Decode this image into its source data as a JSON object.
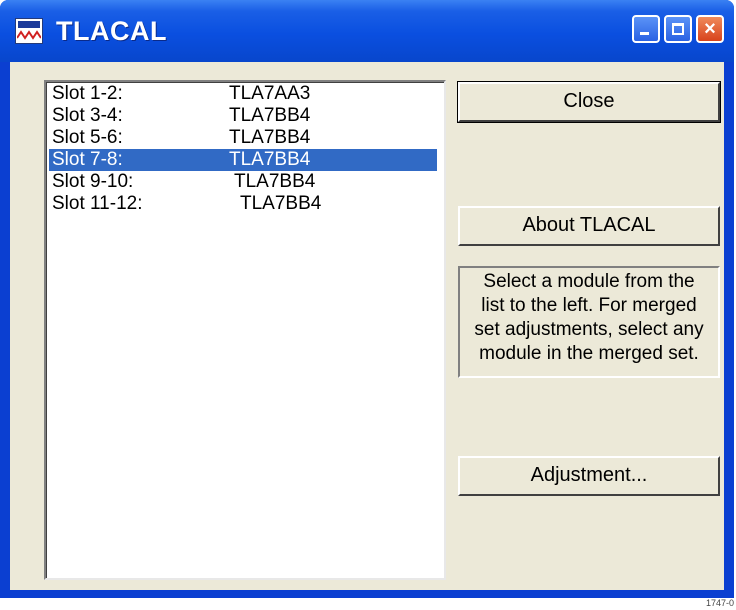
{
  "window": {
    "title": "TLACAL",
    "icon": "tlacal-app-icon",
    "controls": [
      "minimize-icon",
      "maximize-icon",
      "close-icon"
    ],
    "close_glyph": "×"
  },
  "module_list": {
    "rows": [
      {
        "slot": "Slot 1-2:",
        "module": "TLA7AA3",
        "selected": false
      },
      {
        "slot": "Slot 3-4:",
        "module": "TLA7BB4",
        "selected": false
      },
      {
        "slot": "Slot 5-6:",
        "module": "TLA7BB4",
        "selected": false
      },
      {
        "slot": "Slot 7-8:",
        "module": "TLA7BB4",
        "selected": true
      },
      {
        "slot": "Slot 9-10:",
        "module": "TLA7BB4",
        "selected": false
      },
      {
        "slot": "Slot 11-12:",
        "module": "TLA7BB4",
        "selected": false
      }
    ]
  },
  "buttons": {
    "close": "Close",
    "about": "About TLACAL",
    "adjustment": "Adjustment..."
  },
  "info_lines": [
    "Select a module from the",
    "list to the left. For merged",
    "set adjustments, select any",
    "module in the merged set."
  ],
  "figure_code": "1747-0",
  "colors": {
    "titlebar": "#0a4fe0",
    "selection": "#316ac5",
    "dialog_face": "#ece9d8"
  }
}
